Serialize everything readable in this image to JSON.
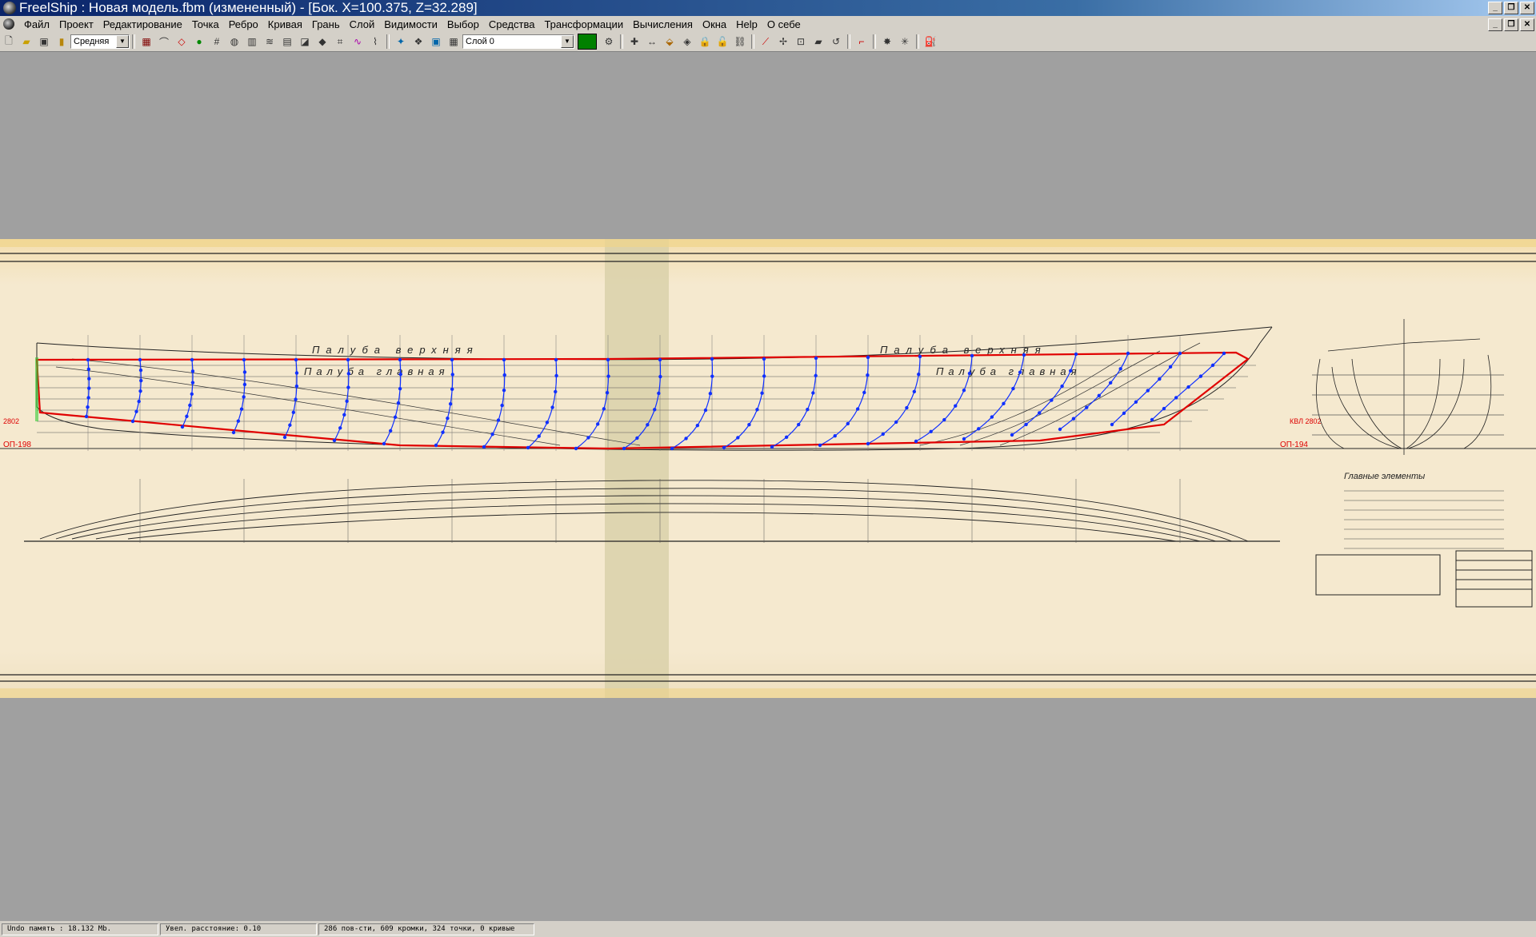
{
  "titlebar": {
    "title": "FreelShip  : Новая модель.fbm (измененный) - [Бок.  X=100.375,   Z=32.289]"
  },
  "menu": {
    "items": [
      "Файл",
      "Проект",
      "Редактирование",
      "Точка",
      "Ребро",
      "Кривая",
      "Грань",
      "Слой",
      "Видимости",
      "Выбор",
      "Средства",
      "Трансформации",
      "Вычисления",
      "Окна",
      "Help",
      "О себе"
    ]
  },
  "toolbar": {
    "precision_value": "Средняя",
    "layer_value": "Слой 0",
    "layer_color": "#008000"
  },
  "drawing": {
    "labels": {
      "deck_upper_left": "Палуба верхняя",
      "deck_upper_right": "Палуба верхняя",
      "deck_main_left": "Палуба главная",
      "deck_main_right": "Палуба главная",
      "op_left": "ОП-198",
      "op_right": "ОП-194",
      "kvl_left": "2802",
      "kvl_right": "КВЛ 2802",
      "main_elements": "Главные элементы"
    }
  },
  "status": {
    "undo": "Undo память : 18.132 Mb.",
    "distance": "Увел. расстояние: 0.10",
    "counts": "286 пов-сти, 609 кромки, 324 точки, 0 кривые"
  }
}
